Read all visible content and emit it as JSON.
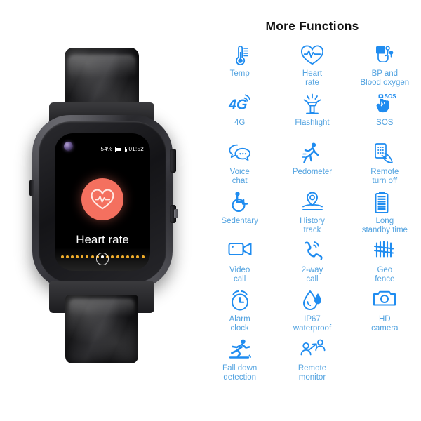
{
  "product": {
    "watch": {
      "status_bar": {
        "battery_percent": "54%",
        "battery_level": 54,
        "time": "01:52"
      },
      "screen_title": "Heart rate",
      "screen_icon": "heart-rate-icon",
      "accent_color": "#f4705f",
      "dot_count": 17,
      "dot_active_index": 8,
      "camera": "front-camera-lens",
      "home_button": "home-button"
    }
  },
  "features": {
    "title": "More Functions",
    "icon_color": "#1f8cf0",
    "caption_color": "#53a3e0",
    "items": [
      {
        "label": "Temp",
        "icon": "thermometer-icon"
      },
      {
        "label": "Heart\nrate",
        "icon": "heart-pulse-icon"
      },
      {
        "label": "BP and\nBlood oxygen",
        "icon": "blood-pressure-cuff-icon"
      },
      {
        "label": "4G",
        "icon": "4g-signal-icon"
      },
      {
        "label": "Flashlight",
        "icon": "flashlight-icon"
      },
      {
        "label": "SOS",
        "icon": "sos-hand-press-icon"
      },
      {
        "label": "Voice\nchat",
        "icon": "speech-bubbles-icon"
      },
      {
        "label": "Pedometer",
        "icon": "running-person-icon"
      },
      {
        "label": "Remote\nturn off",
        "icon": "remote-power-hand-icon"
      },
      {
        "label": "Sedentary",
        "icon": "wheelchair-sedentary-icon"
      },
      {
        "label": "History\ntrack",
        "icon": "map-pin-track-icon"
      },
      {
        "label": "Long\nstandby time",
        "icon": "battery-full-icon"
      },
      {
        "label": "Video\ncall",
        "icon": "video-camera-icon"
      },
      {
        "label": "2-way\ncall",
        "icon": "phone-handset-waves-icon"
      },
      {
        "label": "Geo\nfence",
        "icon": "fence-icon"
      },
      {
        "label": "Alarm\nclock",
        "icon": "alarm-clock-icon"
      },
      {
        "label": "IP67\nwaterproof",
        "icon": "water-drop-icon"
      },
      {
        "label": "HD\ncamera",
        "icon": "camera-icon"
      },
      {
        "label": "Fall down\ndetection",
        "icon": "falling-person-icon"
      },
      {
        "label": "Remote\nmonitor",
        "icon": "two-persons-monitor-icon"
      }
    ]
  }
}
